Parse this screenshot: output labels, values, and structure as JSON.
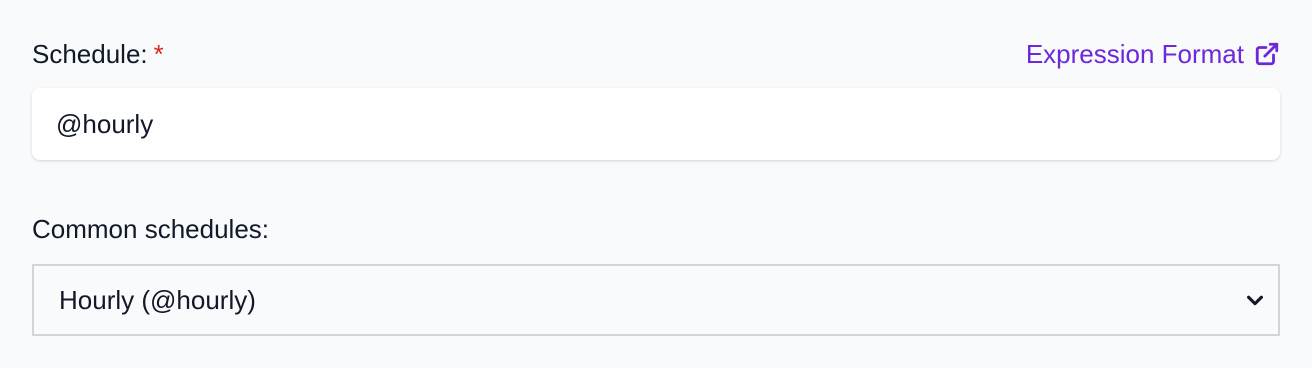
{
  "schedule": {
    "label": "Schedule:",
    "required_marker": "*",
    "value": "@hourly",
    "help_link": {
      "label": "Expression Format",
      "icon": "external-link-icon"
    }
  },
  "common_schedules": {
    "label": "Common schedules:",
    "selected": "Hourly (@hourly)",
    "icon": "chevron-down-icon"
  },
  "colors": {
    "link": "#6d28d9",
    "required": "#dc2626",
    "text": "#111827",
    "border": "#d1d5db",
    "background": "#f9fafb"
  }
}
